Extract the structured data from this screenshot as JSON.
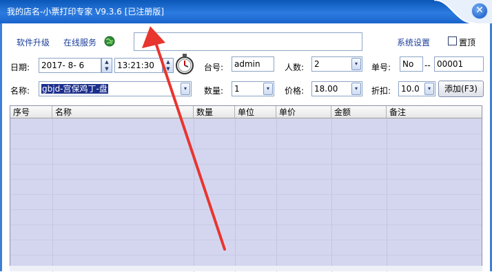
{
  "title": "我的店名-小票打印专家 V9.3.6 [已注册版]",
  "close_glyph": "✕",
  "toolbar": {
    "upgrade": "软件升级",
    "online_service": "在线服务",
    "settings": "系统设置",
    "pin_top": "置顶"
  },
  "form": {
    "date_label": "日期:",
    "date_value": "2017- 8- 6",
    "time_value": "13:21:30",
    "table_label": "台号:",
    "table_value": "admin",
    "people_label": "人数:",
    "people_value": "2",
    "order_label": "单号:",
    "order_prefix": "No",
    "order_sep": "--",
    "order_value": "00001",
    "name_label": "名称:",
    "name_value": "gbjd-宫保鸡丁-盘",
    "qty_label": "数量:",
    "qty_value": "1",
    "price_label": "价格:",
    "price_value": "18.00",
    "discount_label": "折扣:",
    "discount_value": "10.0",
    "add_button": "添加(F3)"
  },
  "grid": {
    "columns": [
      "序号",
      "名称",
      "数量",
      "单位",
      "单价",
      "金额",
      "备注"
    ]
  },
  "icons": {
    "globe": "globe-icon",
    "stopwatch": "stopwatch-icon",
    "dropdown": "▾"
  },
  "colors": {
    "titlebar": "#1a64cc",
    "link": "#1a3e9a",
    "grid_bg": "#d4d6ef",
    "arrow": "#e8352e"
  }
}
